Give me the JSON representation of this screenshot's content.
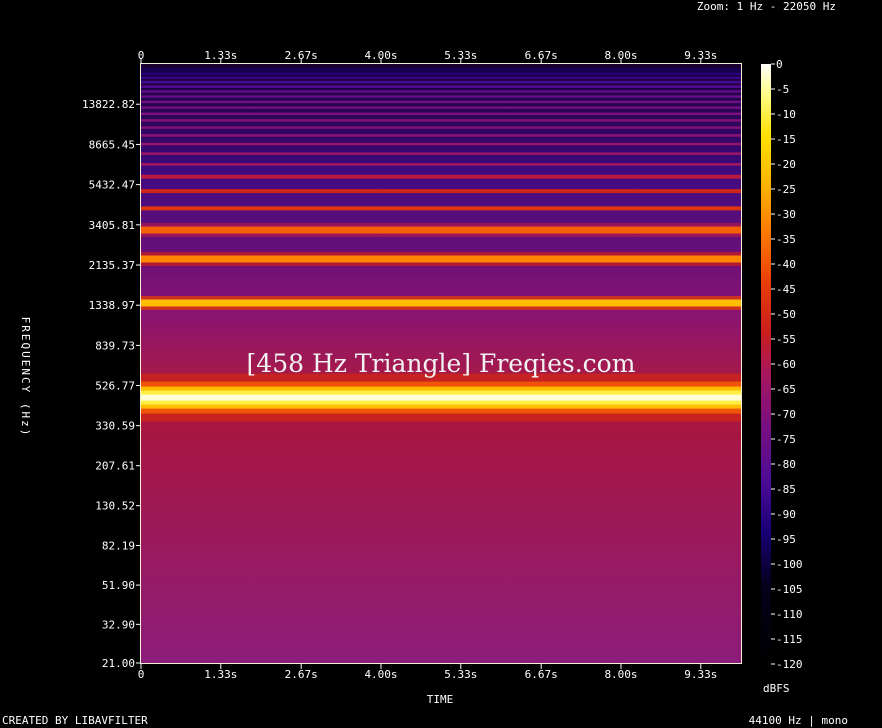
{
  "header": {
    "zoom": "Zoom: 1 Hz - 22050 Hz"
  },
  "footer": {
    "credit": "CREATED BY LIBAVFILTER",
    "info": "44100 Hz | mono"
  },
  "watermark": "[458 Hz Triangle] Freqies.com",
  "colors": {
    "background": "#000000",
    "tick": "#ffffff",
    "frame": "#f3efd2"
  },
  "chart_data": {
    "type": "heatmap",
    "xlabel": "TIME",
    "ylabel": "FREQUENCY (Hz)",
    "colorbar_label": "dBFS",
    "x_ticks": [
      "0",
      "1.33s",
      "2.67s",
      "4.00s",
      "5.33s",
      "6.67s",
      "8.00s",
      "9.33s"
    ],
    "x_tick_values": [
      0,
      1.33,
      2.67,
      4.0,
      5.33,
      6.67,
      8.0,
      9.33
    ],
    "xlim": [
      0,
      10
    ],
    "y_ticks": [
      "21.00",
      "32.90",
      "51.90",
      "82.19",
      "130.52",
      "207.61",
      "330.59",
      "526.77",
      "839.73",
      "1338.97",
      "2135.37",
      "3405.81",
      "5432.47",
      "8665.45",
      "13822.82"
    ],
    "y_scale": "log",
    "ylim": [
      21,
      22050
    ],
    "colorbar_ticks": [
      "0",
      "-5",
      "-10",
      "-15",
      "-20",
      "-25",
      "-30",
      "-35",
      "-40",
      "-45",
      "-50",
      "-55",
      "-60",
      "-65",
      "-70",
      "-75",
      "-80",
      "-85",
      "-90",
      "-95",
      "-100",
      "-105",
      "-110",
      "-115",
      "-120"
    ],
    "colorbar_range": [
      -120,
      0
    ],
    "background_level_dbfs": -68,
    "harmonics": [
      {
        "freq_hz": 458,
        "level_dbfs": -2
      },
      {
        "freq_hz": 1374,
        "level_dbfs": -22
      },
      {
        "freq_hz": 2290,
        "level_dbfs": -32
      },
      {
        "freq_hz": 3206,
        "level_dbfs": -38
      },
      {
        "freq_hz": 4122,
        "level_dbfs": -46
      },
      {
        "freq_hz": 5038,
        "level_dbfs": -52
      },
      {
        "freq_hz": 5954,
        "level_dbfs": -58
      },
      {
        "freq_hz": 6870,
        "level_dbfs": -62
      },
      {
        "freq_hz": 7786,
        "level_dbfs": -64
      },
      {
        "freq_hz": 8702,
        "level_dbfs": -66
      },
      {
        "freq_hz": 9618,
        "level_dbfs": -68
      },
      {
        "freq_hz": 10534,
        "level_dbfs": -70
      },
      {
        "freq_hz": 11450,
        "level_dbfs": -70
      },
      {
        "freq_hz": 12366,
        "level_dbfs": -72
      },
      {
        "freq_hz": 13282,
        "level_dbfs": -74
      },
      {
        "freq_hz": 14198,
        "level_dbfs": -75
      },
      {
        "freq_hz": 15114,
        "level_dbfs": -77
      },
      {
        "freq_hz": 16030,
        "level_dbfs": -79
      },
      {
        "freq_hz": 16946,
        "level_dbfs": -82
      },
      {
        "freq_hz": 17862,
        "level_dbfs": -85
      },
      {
        "freq_hz": 18778,
        "level_dbfs": -88
      },
      {
        "freq_hz": 19694,
        "level_dbfs": -92
      },
      {
        "freq_hz": 20610,
        "level_dbfs": -96
      }
    ]
  }
}
